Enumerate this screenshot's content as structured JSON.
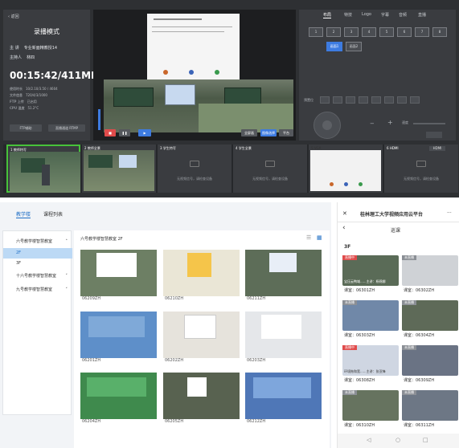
{
  "console": {
    "back": "返回",
    "mode": "录播模式",
    "teacher_label": "主 讲",
    "teacher_value": "专业新面精教授14",
    "host_label": "主持人",
    "host_value": "林四",
    "timer": "00:15:42/411MB",
    "stats": [
      {
        "label": "使用时长",
        "value": "10/2.10/3.50 / 4604"
      },
      {
        "label": "文件信息",
        "value": "720/4/3/1000"
      },
      {
        "label": "FTP 上传",
        "value": "已启用"
      },
      {
        "label": "CPU 温度",
        "value": "51.2°C"
      }
    ],
    "left_buttons": [
      "FTP辅助",
      "直播通道 RTMP"
    ],
    "center_buttons": [
      "全屏画",
      "图像选择",
      "平台"
    ],
    "right_tabs": [
      "布局",
      "特技",
      "Logo",
      "字幕",
      "音频",
      "直播"
    ],
    "layouts": [
      "1",
      "2",
      "3",
      "4",
      "5",
      "6",
      "7",
      "8",
      "9"
    ],
    "layout_selected": [
      "画面1",
      "画面2"
    ],
    "ptz_label": "预置位",
    "zoom_minus": "−",
    "zoom_plus": "+",
    "speed_label": "速度",
    "thumbs": [
      {
        "label": "1 教师特写",
        "sub": ""
      },
      {
        "label": "2 教师全景",
        "sub": ""
      },
      {
        "label": "3 学生特写",
        "sub": "无视频信号，请检查设备"
      },
      {
        "label": "4 学生全景",
        "sub": "无视频信号，请检查设备"
      },
      {
        "label": "5 VGA",
        "sub": ""
      },
      {
        "label": "6 HDMI",
        "sub": "无视频信号，请检查设备"
      }
    ],
    "hdmi_btn": "HDMI"
  },
  "web": {
    "tabs": [
      "教学楼",
      "课程列表"
    ],
    "buildings": [
      {
        "name": "六号教学楼智慧教室",
        "expanded": true
      },
      {
        "name": "十六号教学楼智慧教室",
        "expanded": false
      },
      {
        "name": "九号教学楼智慧教室",
        "expanded": false
      }
    ],
    "floors": [
      "2F",
      "3F"
    ],
    "breadcrumb": "六号教学楼智慧教室 2F",
    "rooms": [
      "06209ZH",
      "06210ZH",
      "06211ZH",
      "06201ZH",
      "06202ZH",
      "06203ZH",
      "06204ZH",
      "06205ZH",
      "06212ZH"
    ]
  },
  "mobile": {
    "title": "桂林理工大学视频应用云平台",
    "close": "✕",
    "more": "···",
    "back": "‹",
    "page_title": "巡课",
    "floor": "3F",
    "rooms": [
      {
        "room": "课室：06301ZH",
        "badge": "直播中",
        "badge_color": "#e04b4b",
        "caption": "宝压云鸭域......主讲：杨锦娜"
      },
      {
        "room": "课室：06302ZH",
        "badge": "未直播",
        "badge_color": "#8b8f95",
        "caption": ""
      },
      {
        "room": "课室：06303ZH",
        "badge": "未直播",
        "badge_color": "#8b8f95",
        "caption": ""
      },
      {
        "room": "课室：06304ZH",
        "badge": "未直播",
        "badge_color": "#8b8f95",
        "caption": ""
      },
      {
        "room": "课室：06308ZH",
        "badge": "直播中",
        "badge_color": "#e04b4b",
        "caption": "环境拖和宽......主讲：张亚锋"
      },
      {
        "room": "课室：06309ZH",
        "badge": "未直播",
        "badge_color": "#8b8f95",
        "caption": ""
      },
      {
        "room": "课室：06310ZH",
        "badge": "未直播",
        "badge_color": "#8b8f95",
        "caption": ""
      },
      {
        "room": "课室：06311ZH",
        "badge": "未直播",
        "badge_color": "#8b8f95",
        "caption": ""
      }
    ],
    "nav": [
      "◁",
      "○",
      "□"
    ]
  },
  "colors": {
    "accent": "#3d7be0",
    "live": "#e04b4b",
    "console_bg": "#2e3033"
  }
}
